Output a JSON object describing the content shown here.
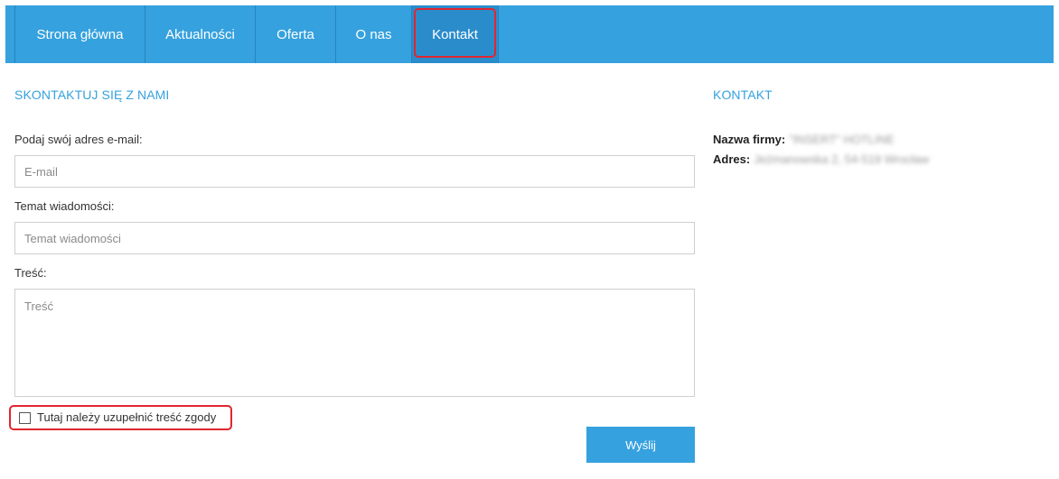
{
  "nav": {
    "items": [
      {
        "label": "Strona główna"
      },
      {
        "label": "Aktualności"
      },
      {
        "label": "Oferta"
      },
      {
        "label": "O nas"
      },
      {
        "label": "Kontakt"
      }
    ],
    "active": "Kontakt"
  },
  "form": {
    "title": "SKONTAKTUJ SIĘ Z NAMI",
    "email": {
      "label": "Podaj swój adres e-mail:",
      "placeholder": "E-mail",
      "value": ""
    },
    "subject": {
      "label": "Temat wiadomości:",
      "placeholder": "Temat wiadomości",
      "value": ""
    },
    "body": {
      "label": "Treść:",
      "placeholder": "Treść",
      "value": ""
    },
    "consent": {
      "label": "Tutaj należy uzupełnić treść zgody",
      "checked": false
    },
    "submit_label": "Wyślij"
  },
  "contact": {
    "title": "KONTAKT",
    "company": {
      "key": "Nazwa firmy:",
      "value": "\"INSERT\" HOTLINE"
    },
    "address": {
      "key": "Adres:",
      "value": "Jeżmanowska 2, 54-519 Wrocław"
    }
  },
  "colors": {
    "accent": "#35a1de",
    "highlight": "#e0262f"
  }
}
